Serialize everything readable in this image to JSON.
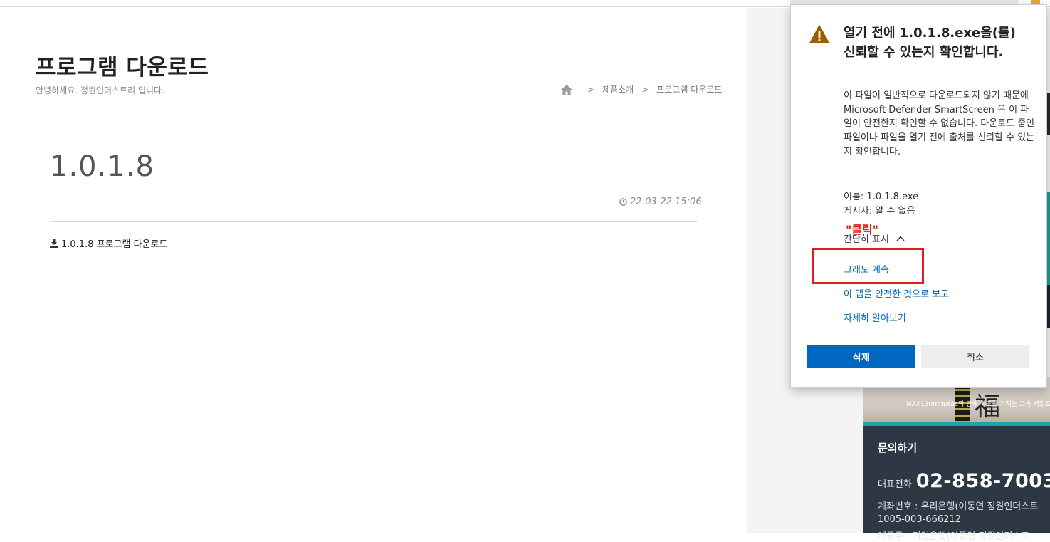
{
  "page": {
    "title": "프로그램 다운로드",
    "subtitle": "안녕하세요. 정원인더스트리 입니다.",
    "breadcrumb": {
      "items": [
        "제품소개",
        "프로그램 다운로드"
      ]
    },
    "post": {
      "title": "1.0.1.8",
      "date": "22-03-22 15:06",
      "download_label": "1.0.1.8 프로그램 다운로드"
    }
  },
  "sidebar": {
    "image_caption": "MAX130mm/sec의 인쇄 속도를 가지는 고속 서멀프",
    "image_glyph": "福",
    "contact": {
      "heading": "문의하기",
      "phone_label": "대표전화",
      "phone": "02-858-7003",
      "account_label": "계좌번호 : 우리은행(이동연 정원인더스트",
      "account_number": "1005-003-666212",
      "account_label2": "예금주 : 기업은행(이동연 정원인더스트"
    }
  },
  "dialog": {
    "title": "열기 전에 1.0.1.8.exe을(를) 신뢰할 수 있는지 확인합니다.",
    "body": "이 파일이 일반적으로 다운로드되지 않기 때문에 Microsoft Defender SmartScreen 은 이 파일이 안전한지 확인할 수 없습니다. 다운로드 중인 파일이나 파일을 열기 전에 출처를 신뢰할 수 있는지 확인합니다.",
    "name_line": "이름: 1.0.1.8.exe",
    "publisher_line": "게시자: 알 수 없음",
    "show_less": "간단히 표시",
    "link_continue": "그래도 계속",
    "link_report_safe": "이 앱을 안전한 것으로 보고",
    "link_learn_more": "자세히 알아보기",
    "btn_delete": "삭제",
    "btn_cancel": "취소"
  },
  "annotation": {
    "text": "\"클릭\"",
    "color": "#e11d1d"
  },
  "colors": {
    "accent_blue": "#0067c0",
    "link_blue": "#0067b8",
    "warning_amber": "#9c5d00",
    "sidebar_dark": "#2e3744",
    "teal": "#1aa6a6"
  }
}
